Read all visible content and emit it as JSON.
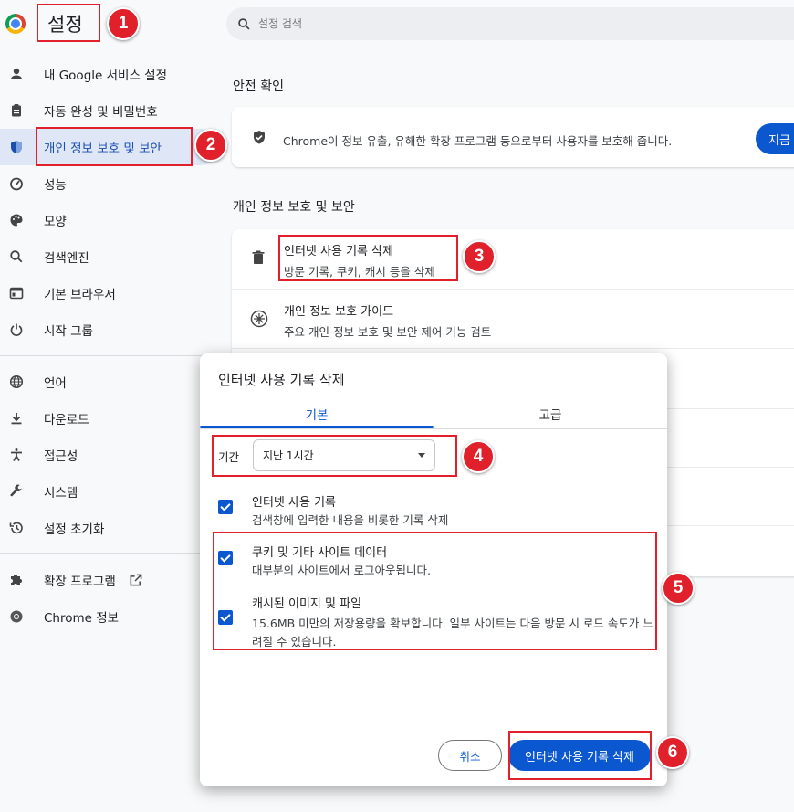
{
  "app_title": "설정",
  "search": {
    "placeholder": "설정 검색"
  },
  "sidebar": {
    "items": [
      {
        "label": "내 Google 서비스 설정",
        "icon": "person-icon"
      },
      {
        "label": "자동 완성 및 비밀번호",
        "icon": "clipboard-icon"
      },
      {
        "label": "개인 정보 보호 및 보안",
        "icon": "shield-icon"
      },
      {
        "label": "성능",
        "icon": "speedometer-icon"
      },
      {
        "label": "모양",
        "icon": "palette-icon"
      },
      {
        "label": "검색엔진",
        "icon": "search-icon"
      },
      {
        "label": "기본 브라우저",
        "icon": "browser-icon"
      },
      {
        "label": "시작 그룹",
        "icon": "power-icon"
      },
      {
        "label": "언어",
        "icon": "globe-icon"
      },
      {
        "label": "다운로드",
        "icon": "download-icon"
      },
      {
        "label": "접근성",
        "icon": "accessibility-icon"
      },
      {
        "label": "시스템",
        "icon": "wrench-icon"
      },
      {
        "label": "설정 초기화",
        "icon": "history-icon"
      },
      {
        "label": "확장 프로그램",
        "icon": "puzzle-icon"
      },
      {
        "label": "Chrome 정보",
        "icon": "chrome-icon"
      }
    ]
  },
  "main": {
    "safety_title": "안전 확인",
    "safety_text": "Chrome이 정보 유출, 유해한 확장 프로그램 등으로부터 사용자를 보호해 줍니다.",
    "safety_button": "지금",
    "privacy_title": "개인 정보 보호 및 보안",
    "rows": [
      {
        "title": "인터넷 사용 기록 삭제",
        "sub": "방문 기록, 쿠키, 캐시 등을 삭제"
      },
      {
        "title": "개인 정보 보호 가이드",
        "sub": "주요 개인 정보 보호 및 보안 제어 기능 검토"
      }
    ]
  },
  "dialog": {
    "title": "인터넷 사용 기록 삭제",
    "tabs": [
      "기본",
      "고급"
    ],
    "range_label": "기간",
    "range_value": "지난 1시간",
    "options": [
      {
        "title": "인터넷 사용 기록",
        "sub": "검색창에 입력한 내용을 비롯한 기록 삭제",
        "checked": true
      },
      {
        "title": "쿠키 및 기타 사이트 데이터",
        "sub": "대부분의 사이트에서 로그아웃됩니다.",
        "checked": true
      },
      {
        "title": "캐시된 이미지 및 파일",
        "sub": "15.6MB 미만의 저장용량을 확보합니다. 일부 사이트는 다음 방문 시 로드 속도가 느려질 수 있습니다.",
        "checked": true
      }
    ],
    "cancel": "취소",
    "confirm": "인터넷 사용 기록 삭제"
  },
  "annotations": [
    "1",
    "2",
    "3",
    "4",
    "5",
    "6"
  ],
  "colors": {
    "accent": "#0b57d0",
    "annotation": "#e0202a",
    "active_bg": "#dfe7f7"
  }
}
